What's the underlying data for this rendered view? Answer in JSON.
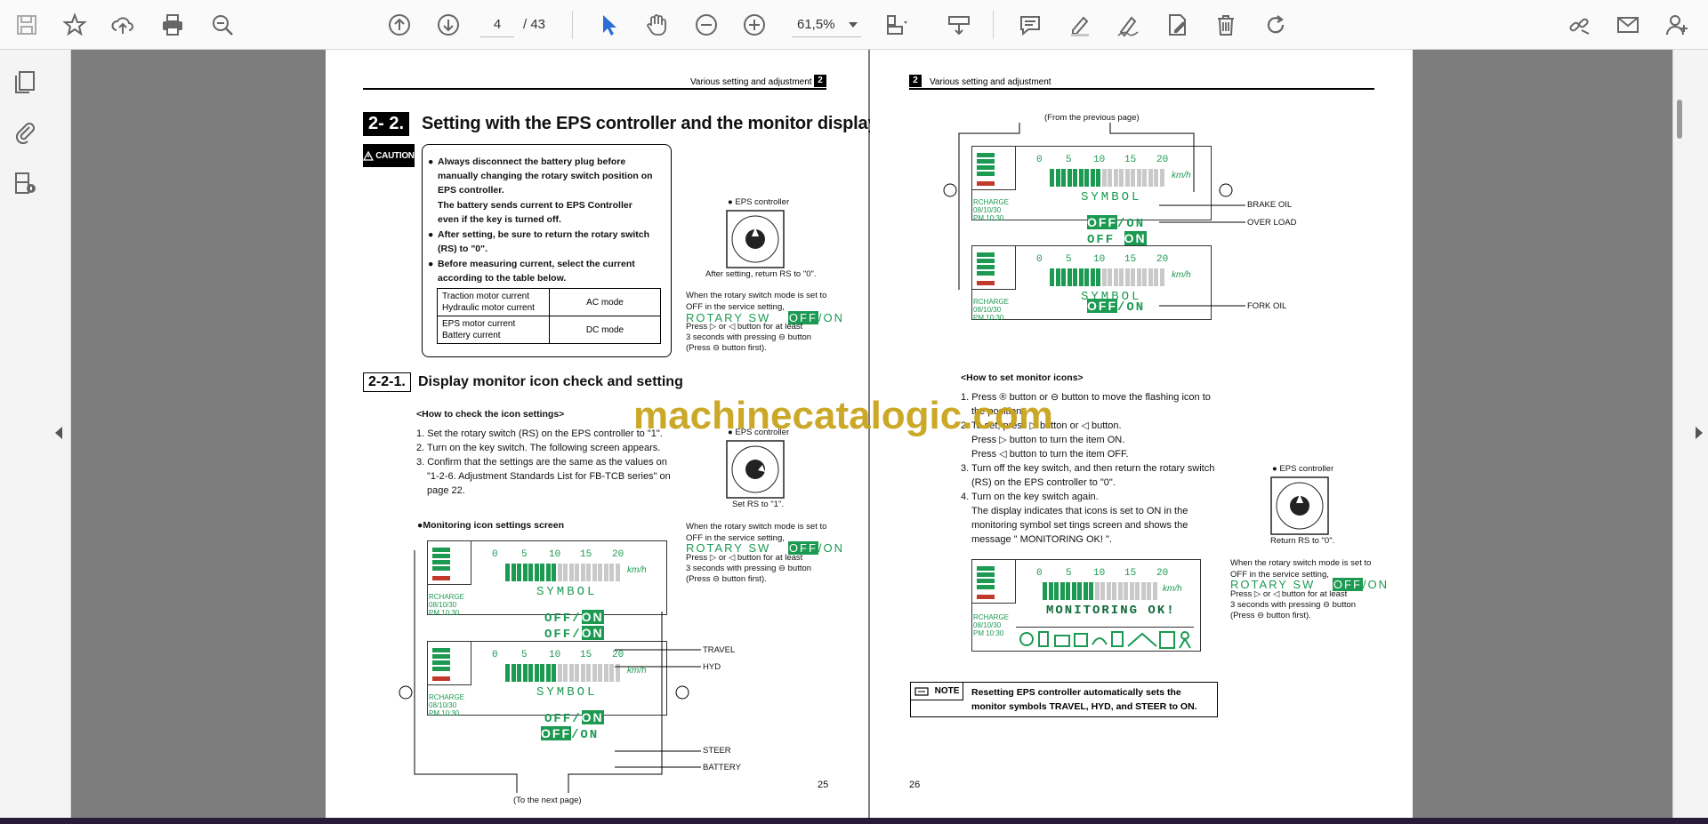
{
  "toolbar": {
    "page_current": "4",
    "page_total": "/ 43",
    "zoom": "61,5%"
  },
  "left_page": {
    "header": "Various setting and adjustment",
    "chapter": "2",
    "section_number": "2- 2.",
    "section_title": "Setting with the EPS controller and the monitor display",
    "caution_label": "CAUTION",
    "caution_items": [
      "Always disconnect the battery plug before manually changing the rotary switch position on EPS controller.",
      "The battery sends current to EPS Controller even if the key is turned off.",
      "After setting, be sure to return the rotary switch (RS) to \"0\".",
      "Before measuring current, select the current according to the table below."
    ],
    "table": [
      {
        "items": "Traction motor current\nHydraulic motor current",
        "mode": "AC mode"
      },
      {
        "items": "EPS motor current\nBattery current",
        "mode": "DC mode"
      }
    ],
    "eps_label": "EPS controller",
    "after_setting": "After setting, return RS to \"0\".",
    "rotary_note": "When the rotary switch mode is set to OFF in the service setting,",
    "rotary_display": "ROTARY SW",
    "rotary_off": "OFF",
    "rotary_on": "/ON",
    "press_note_1": "Press ▷ or ◁ button for at least",
    "press_note_2": "3 seconds with pressing ⊖ button",
    "press_note_3": "(Press ⊖ button first).",
    "subsection_number": "2-2-1.",
    "subsection_title": "Display monitor icon check and setting",
    "howto_title": "<How to check the icon settings>",
    "steps": [
      "1. Set the rotary switch (RS) on the EPS controller to \"1\".",
      "2. Turn on the key switch. The following screen appears.",
      "3. Confirm that the settings are the same as the values on \"1-2-6. Adjustment Standards List for FB-TCB series\" on page 22."
    ],
    "set_rs": "Set RS to \"1\".",
    "monitor_screen": "Monitoring icon settings screen",
    "labels": [
      "TRAVEL",
      "HYD",
      "STEER",
      "BATTERY"
    ],
    "to_next": "(To the next page)",
    "page_number": "25"
  },
  "right_page": {
    "header": "Various setting and adjustment",
    "chapter": "2",
    "from_prev": "(From the previous page)",
    "labels": [
      "BRAKE OIL",
      "OVER LOAD",
      "FORK OIL"
    ],
    "howto_title": "<How to set monitor icons>",
    "steps": [
      "1. Press ® button or ⊖ button to move the flashing icon to the position.",
      "2. To set, press ▷ button or ◁ button.",
      "Press ▷ button to turn the item ON.",
      "Press ◁ button to turn the item OFF.",
      "3. Turn off the key switch, and then return the rotary switch (RS) on the EPS controller to \"0\".",
      "4. Turn on the key switch again.",
      "The display indicates that icons is set to ON in the monitoring symbol set tings screen and shows the message \" MONITORING OK! \"."
    ],
    "eps_label": "EPS controller",
    "return_rs": "Return RS to \"0\".",
    "monitoring_ok": "MONITORING  OK!",
    "note_label": "NOTE",
    "note_text": "Resetting EPS controller automatically sets the monitor symbols TRAVEL, HYD, and STEER to ON.",
    "page_number": "26"
  },
  "lcd": {
    "speed_scale": [
      "0",
      "5",
      "10",
      "15",
      "20"
    ],
    "unit": "km/h",
    "symbol": "SYMBOL",
    "recharge": "RCHARGE",
    "date": "08/10/30",
    "time": "PM 10:30",
    "off_on": "OFF/ON",
    "off": "OFF",
    "on": "ON"
  },
  "watermark": "machinecatalogic.com",
  "colors": {
    "lcd_green": "#1c9a52",
    "watermark": "#c9a41c"
  }
}
